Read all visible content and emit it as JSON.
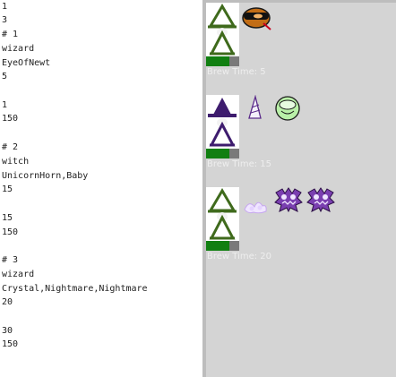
{
  "text_lines": [
    "1",
    "3",
    "# 1",
    "wizard",
    "EyeOfNewt",
    "5",
    "",
    "1",
    "150",
    "",
    "# 2",
    "witch",
    "UnicornHorn,Baby",
    "15",
    "",
    "15",
    "150",
    "",
    "# 3",
    "wizard",
    "Crystal,Nightmare,Nightmare",
    "20",
    "",
    "30",
    "150"
  ],
  "slots": [
    {
      "character": "wizard-icon",
      "ingredients": [
        "eye-of-newt-icon"
      ],
      "brew_label": "Brew Time: 5",
      "progress": 0.7
    },
    {
      "character": "witch-icon",
      "ingredients": [
        "unicorn-horn-icon",
        "baby-icon"
      ],
      "brew_label": "Brew Time: 15",
      "progress": 0.7
    },
    {
      "character": "wizard-icon",
      "ingredients": [
        "crystal-icon",
        "nightmare-icon",
        "nightmare-icon"
      ],
      "brew_label": "Brew Time: 20",
      "progress": 0.7
    }
  ],
  "colors": {
    "wizard_hat": "#3f6a1c",
    "witch_hat": "#3e1c6e",
    "progress_fill": "#117f11",
    "progress_track": "#7a7a7a",
    "game_background": "#d4d4d4",
    "nightmare": "#7a3fb0"
  }
}
